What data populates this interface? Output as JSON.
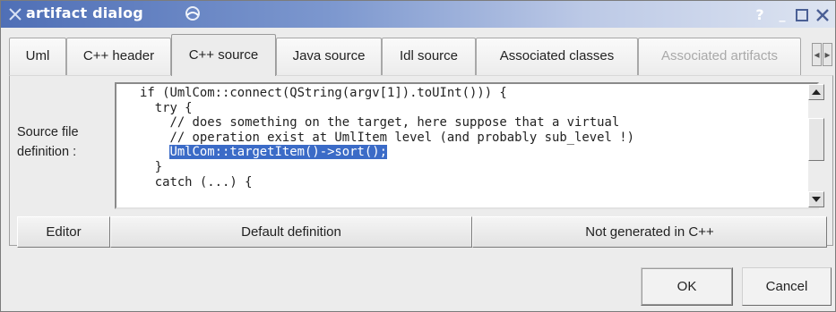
{
  "window": {
    "title": "artifact dialog",
    "controls": {
      "help": "?",
      "minimize": "_",
      "maximize": "□",
      "close": "X"
    }
  },
  "tabs": [
    {
      "label": "Uml",
      "state": "normal"
    },
    {
      "label": "C++ header",
      "state": "normal"
    },
    {
      "label": "C++ source",
      "state": "active"
    },
    {
      "label": "Java source",
      "state": "normal"
    },
    {
      "label": "Idl source",
      "state": "normal"
    },
    {
      "label": "Associated classes",
      "state": "normal"
    },
    {
      "label": "Associated artifacts",
      "state": "disabled"
    }
  ],
  "tab_scroll": {
    "left": "◂",
    "right": "▸"
  },
  "source": {
    "label_line1": "Source file",
    "label_line2": "definition :",
    "code": {
      "line1": "if (UmlCom::connect(QString(argv[1]).toUInt())) {",
      "line2": "  try {",
      "line3": "    // does something on the target, here suppose that a virtual",
      "line4": "    // operation exist at UmlItem level (and probably sub_level !)",
      "line5_selected": "UmlCom::targetItem()->sort();",
      "line6": "  }",
      "line7": "  catch (...) {"
    },
    "scroll": {
      "up": "▲",
      "down": "▼"
    }
  },
  "pane_buttons": {
    "editor": "Editor",
    "default_definition": "Default definition",
    "not_generated": "Not generated in C++"
  },
  "dialog_buttons": {
    "ok": "OK",
    "cancel": "Cancel"
  },
  "colors": {
    "selection": "#3b6bc7",
    "titlebar": "#4f6fb6"
  }
}
